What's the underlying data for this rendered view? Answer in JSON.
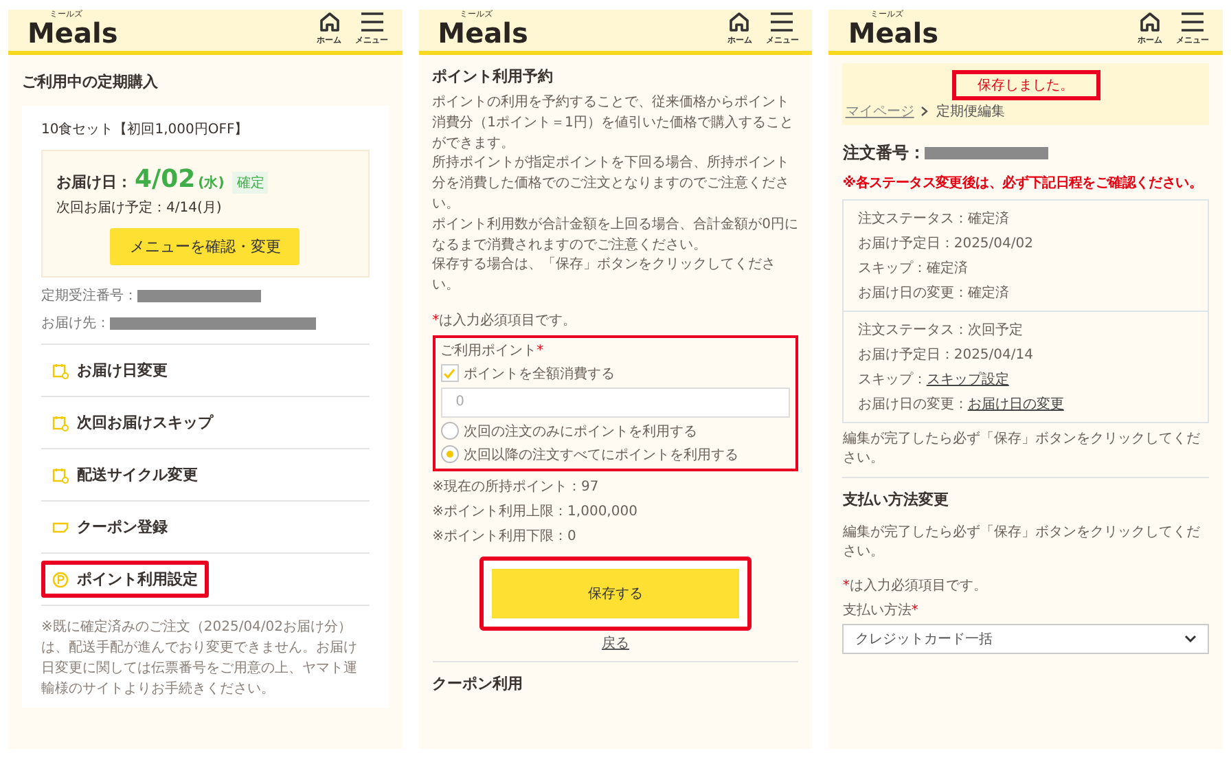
{
  "screens": [
    {
      "kind": "subscription",
      "header": {
        "logo_ruby": "ミールズ",
        "logo": "Meals",
        "nav": [
          "ホーム",
          "メニュー"
        ]
      },
      "title": "ご利用中の定期購入",
      "card": {
        "product": "10食セット【初回1,000円OFF】",
        "delivery_label": "お届け日：",
        "delivery_date": "4/02",
        "delivery_weekday": "(水)",
        "badge": "確定",
        "next_delivery": "次回お届け予定：4/14(月)",
        "button": "メニューを確認・変更"
      },
      "info": [
        {
          "label": "定期受注番号：",
          "redacted": true
        },
        {
          "label": "お届け先：",
          "redacted": true
        }
      ],
      "menu": [
        {
          "label": "お届け日変更",
          "highlighted": false
        },
        {
          "label": "次回お届けスキップ",
          "highlighted": false
        },
        {
          "label": "配送サイクル変更",
          "highlighted": false
        },
        {
          "label": "クーポン登録",
          "highlighted": false
        },
        {
          "label": "ポイント利用設定",
          "highlighted": true
        }
      ],
      "note": "※既に確定済みのご注文（2025/04/02お届け分）は、配送手配が進んでおり変更できません。お届け日変更に関しては伝票番号をご用意の上、ヤマト運輸様のサイトよりお手続きください。"
    },
    {
      "kind": "points",
      "header": {
        "logo_ruby": "ミールズ",
        "logo": "Meals",
        "nav": [
          "ホーム",
          "メニュー"
        ]
      },
      "title": "ポイント利用予約",
      "paragraphs": [
        "ポイントの利用を予約することで、従来価格からポイント消費分（1ポイント＝1円）を値引いた価格で購入することができます。",
        "所持ポイントが指定ポイントを下回る場合、所持ポイント分を消費した価格でのご注文となりますのでご注意ください。",
        "ポイント利用数が合計金額を上回る場合、合計金額が0円になるまで消費されますのでご注意ください。",
        "保存する場合は、「保存」ボタンをクリックしてください。"
      ],
      "required_note": {
        "mark": "*",
        "text": "は入力必須項目です。"
      },
      "form": {
        "highlighted": true,
        "label": "ご利用ポイント",
        "required_mark": "*",
        "checkbox": {
          "label": "ポイントを全額消費する",
          "checked": true
        },
        "input": {
          "placeholder": "0"
        },
        "radios": [
          {
            "label": "次回の注文のみにポイントを利用する",
            "selected": false
          },
          {
            "label": "次回以降の注文すべてにポイントを利用する",
            "selected": true
          }
        ]
      },
      "info": [
        "※現在の所持ポイント：97",
        "※ポイント利用上限：1,000,000",
        "※ポイント利用下限：0"
      ],
      "save_button": {
        "label": "保存する",
        "highlighted": true
      },
      "back_link": "戻る",
      "next_section": "クーポン利用"
    },
    {
      "kind": "order",
      "header": {
        "logo_ruby": "ミールズ",
        "logo": "Meals",
        "nav": [
          "ホーム",
          "メニュー"
        ]
      },
      "flash": {
        "text": "保存しました。",
        "highlighted": true
      },
      "breadcrumb": [
        {
          "label": "マイページ",
          "link": true
        },
        {
          "label": "定期便編集",
          "link": false
        }
      ],
      "order_number": {
        "label": "注文番号：",
        "redacted": true
      },
      "warning": "※各ステータス変更後は、必ず下記日程をご確認ください。",
      "schedules": [
        [
          {
            "label": "注文ステータス：",
            "value": "確定済",
            "link": false
          },
          {
            "label": "お届け予定日：",
            "value": "2025/04/02",
            "link": false
          },
          {
            "label": "スキップ：",
            "value": "確定済",
            "link": false
          },
          {
            "label": "お届け日の変更：",
            "value": "確定済",
            "link": false
          }
        ],
        [
          {
            "label": "注文ステータス：",
            "value": "次回予定",
            "link": false
          },
          {
            "label": "お届け予定日：",
            "value": "2025/04/14",
            "link": false
          },
          {
            "label": "スキップ：",
            "value": "スキップ設定",
            "link": true
          },
          {
            "label": "お届け日の変更：",
            "value": "お届け日の変更",
            "link": true
          }
        ]
      ],
      "edit_note": "編集が完了したら必ず「保存」ボタンをクリックしてください。",
      "payment": {
        "title": "支払い方法変更",
        "note": "編集が完了したら必ず「保存」ボタンをクリックしてください。",
        "required_note": {
          "mark": "*",
          "text": "は入力必須項目です。"
        },
        "label": "支払い方法",
        "required_mark": "*",
        "value": "クレジットカード一括"
      }
    }
  ]
}
